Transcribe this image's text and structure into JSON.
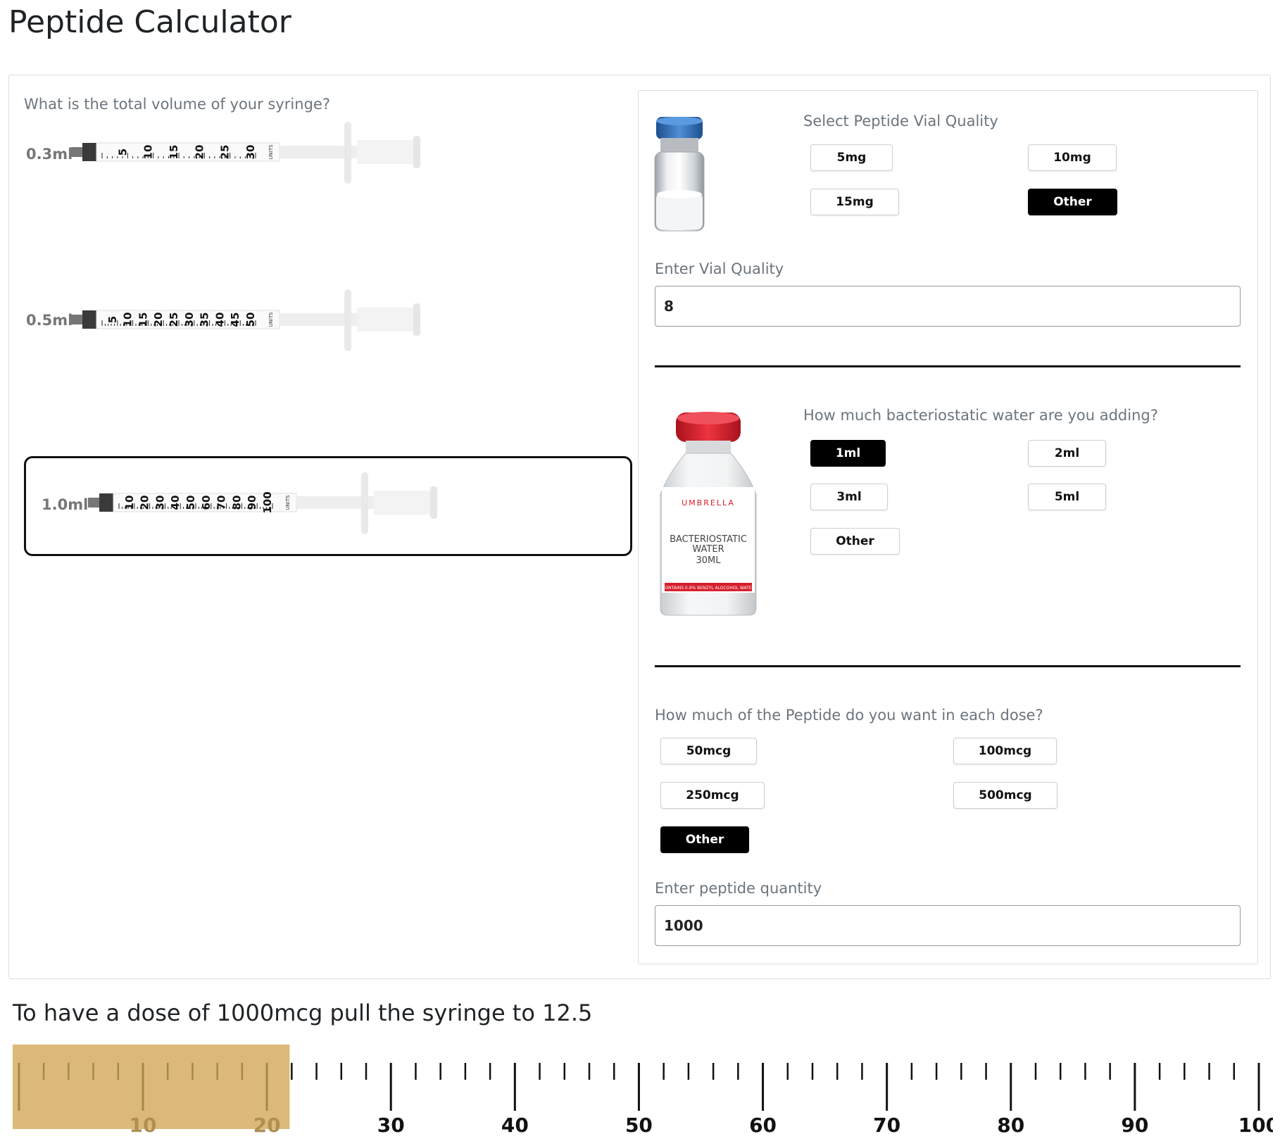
{
  "page_title": "Peptide Calculator",
  "syringe": {
    "question": "What is the total volume of your syringe?",
    "options": [
      {
        "label": "0.3ml",
        "selected": false,
        "scale": [
          "5",
          "10",
          "15",
          "20",
          "25",
          "30"
        ]
      },
      {
        "label": "0.5ml",
        "selected": false,
        "scale": [
          "5",
          "10",
          "15",
          "20",
          "25",
          "30",
          "35",
          "40",
          "45",
          "50"
        ]
      },
      {
        "label": "1.0ml",
        "selected": true,
        "scale": [
          "10",
          "20",
          "30",
          "40",
          "50",
          "60",
          "70",
          "80",
          "90",
          "100"
        ]
      }
    ],
    "units_mark": "UNITS"
  },
  "vial": {
    "question": "Select Peptide Vial Quality",
    "options": [
      {
        "label": "5mg",
        "active": false
      },
      {
        "label": "10mg",
        "active": false
      },
      {
        "label": "15mg",
        "active": false
      },
      {
        "label": "Other",
        "active": true
      }
    ],
    "input_label": "Enter Vial Quality",
    "input_value": "8"
  },
  "water": {
    "question": "How much bacteriostatic water are you adding?",
    "options": [
      {
        "label": "1ml",
        "active": true
      },
      {
        "label": "2ml",
        "active": false
      },
      {
        "label": "3ml",
        "active": false
      },
      {
        "label": "5ml",
        "active": false
      },
      {
        "label": "Other",
        "active": false
      }
    ],
    "bottle": {
      "brand": "UMBRELLA",
      "line1": "BACTERIOSTATIC",
      "line2": "WATER",
      "line3": "30ML",
      "band": "CONTAINS 0.9% BENZYL ALOCOHOL WATER"
    }
  },
  "dose": {
    "question": "How much of the Peptide do you want in each dose?",
    "options": [
      {
        "label": "50mcg",
        "active": false
      },
      {
        "label": "100mcg",
        "active": false
      },
      {
        "label": "250mcg",
        "active": false
      },
      {
        "label": "500mcg",
        "active": false
      },
      {
        "label": "Other",
        "active": true
      }
    ],
    "input_label": "Enter peptide quantity",
    "input_value": "1000"
  },
  "result": {
    "text": "To have a dose of 1000mcg pull the syringe to 12.5",
    "pull_to": 12.5,
    "scale_max": 100,
    "labels": [
      "10",
      "20",
      "30",
      "40",
      "50",
      "60",
      "70",
      "80",
      "90",
      "100"
    ]
  },
  "colors": {
    "active_button": "#000000",
    "fill_highlight": "#dcb97a",
    "vial_cap_blue": "#2f6fb6",
    "water_cap_red": "#d61f2b"
  }
}
